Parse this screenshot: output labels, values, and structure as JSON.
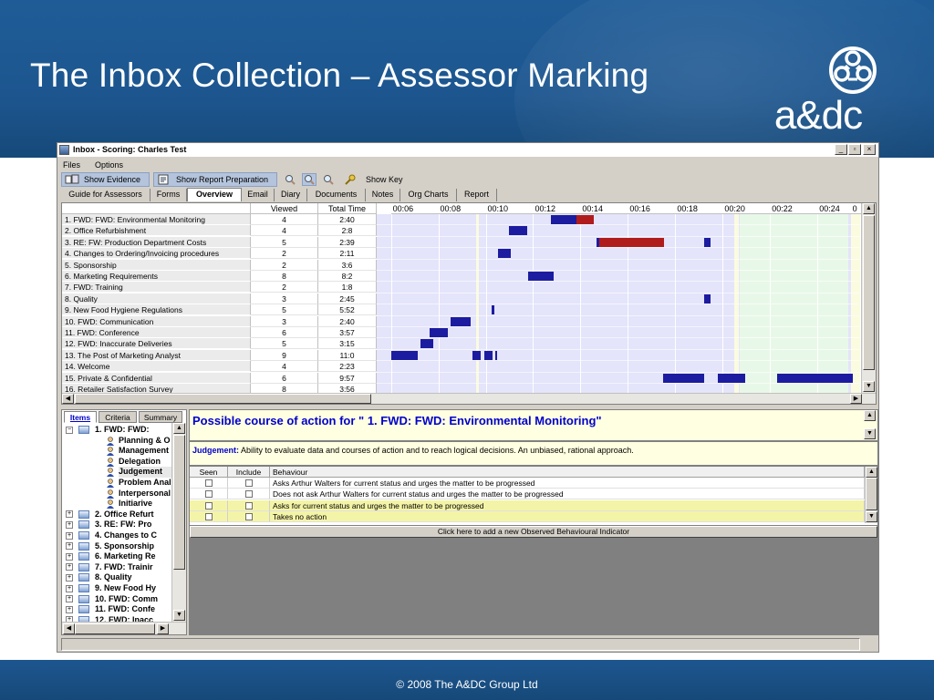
{
  "slide": {
    "title": "The Inbox Collection – Assessor Marking",
    "logo_text": "a&dc",
    "footer": "© 2008 The A&DC Group Ltd",
    "header_color": "#1d568f"
  },
  "window": {
    "title": "Inbox - Scoring: Charles Test",
    "controls": [
      "_",
      "▫",
      "×"
    ]
  },
  "menu": {
    "files": "Files",
    "options": "Options"
  },
  "toolbar": {
    "show_evidence": "Show Evidence",
    "show_report_preparation": "Show Report Preparation",
    "show_key": "Show Key",
    "icons": [
      "magnifier-icon",
      "zoom-in-icon",
      "zoom-out-icon",
      "key-icon"
    ]
  },
  "tabs": [
    "Guide for Assessors",
    "Forms",
    "Overview",
    "Email",
    "Diary",
    "Documents",
    "Notes",
    "Org Charts",
    "Report"
  ],
  "active_tab": "Overview",
  "overview": {
    "columns": {
      "viewed": "Viewed",
      "total_time": "Total Time"
    },
    "time_ticks": [
      "00:06",
      "00:08",
      "00:10",
      "00:12",
      "00:14",
      "00:16",
      "00:18",
      "00:20",
      "00:22",
      "00:24",
      "0"
    ],
    "rows": [
      {
        "name": "1. FWD: FWD: Environmental Monitoring",
        "viewed": "4",
        "total": "2:40"
      },
      {
        "name": "2. Office Refurbishment",
        "viewed": "4",
        "total": "2:8"
      },
      {
        "name": "3. RE: FW: Production Department Costs",
        "viewed": "5",
        "total": "2:39"
      },
      {
        "name": "4. Changes to Ordering/Invoicing procedures",
        "viewed": "2",
        "total": "2:11"
      },
      {
        "name": "5. Sponsorship",
        "viewed": "2",
        "total": "3:6"
      },
      {
        "name": "6. Marketing Requirements",
        "viewed": "8",
        "total": "8:2"
      },
      {
        "name": "7. FWD: Training",
        "viewed": "2",
        "total": "1:8"
      },
      {
        "name": "8. Quality",
        "viewed": "3",
        "total": "2:45"
      },
      {
        "name": "9. New Food Hygiene Regulations",
        "viewed": "5",
        "total": "5:52"
      },
      {
        "name": "10. FWD: Communication",
        "viewed": "3",
        "total": "2:40"
      },
      {
        "name": "11. FWD: Conference",
        "viewed": "6",
        "total": "3:57"
      },
      {
        "name": "12. FWD: Inaccurate Deliveries",
        "viewed": "5",
        "total": "3:15"
      },
      {
        "name": "13. The Post of Marketing Analyst",
        "viewed": "9",
        "total": "11:0"
      },
      {
        "name": "14. Welcome",
        "viewed": "4",
        "total": "2:23"
      },
      {
        "name": "15. Private & Confidential",
        "viewed": "6",
        "total": "9:57"
      },
      {
        "name": "16. Retailer Satisfaction Survey",
        "viewed": "8",
        "total": "3:56"
      }
    ],
    "bar_colors": {
      "viewing": "#1c1ca0",
      "current": "#b01c1c",
      "lilac_band": "#e4e4fb",
      "green_band": "#e8f8e8"
    },
    "bars": [
      {
        "row": 0,
        "start": 12.75,
        "end": 13.82,
        "kind": "viewing"
      },
      {
        "row": 0,
        "start": 13.82,
        "end": 14.55,
        "kind": "current"
      },
      {
        "row": 1,
        "start": 11.0,
        "end": 11.75,
        "kind": "viewing"
      },
      {
        "row": 2,
        "start": 14.68,
        "end": 14.8,
        "kind": "viewing"
      },
      {
        "row": 2,
        "start": 14.8,
        "end": 17.52,
        "kind": "current"
      },
      {
        "row": 2,
        "start": 19.2,
        "end": 19.5,
        "kind": "viewing"
      },
      {
        "row": 3,
        "start": 10.5,
        "end": 11.05,
        "kind": "viewing"
      },
      {
        "row": 5,
        "start": 11.8,
        "end": 12.85,
        "kind": "viewing"
      },
      {
        "row": 7,
        "start": 19.2,
        "end": 19.5,
        "kind": "viewing"
      },
      {
        "row": 8,
        "start": 10.25,
        "end": 10.35,
        "kind": "viewing"
      },
      {
        "row": 9,
        "start": 8.5,
        "end": 9.35,
        "kind": "viewing"
      },
      {
        "row": 10,
        "start": 7.65,
        "end": 8.4,
        "kind": "viewing"
      },
      {
        "row": 11,
        "start": 7.25,
        "end": 7.8,
        "kind": "viewing"
      },
      {
        "row": 12,
        "start": 6.0,
        "end": 7.15,
        "kind": "viewing"
      },
      {
        "row": 12,
        "start": 9.45,
        "end": 9.8,
        "kind": "viewing"
      },
      {
        "row": 12,
        "start": 9.95,
        "end": 10.3,
        "kind": "viewing"
      },
      {
        "row": 12,
        "start": 10.4,
        "end": 10.5,
        "kind": "viewing"
      },
      {
        "row": 14,
        "start": 17.5,
        "end": 19.2,
        "kind": "viewing"
      },
      {
        "row": 14,
        "start": 19.8,
        "end": 20.95,
        "kind": "viewing"
      },
      {
        "row": 14,
        "start": 22.3,
        "end": 25.5,
        "kind": "viewing"
      }
    ]
  },
  "left_tabs": [
    "Items",
    "Criteria",
    "Summary"
  ],
  "tree": [
    {
      "label": "1. FWD: FWD:",
      "level": 0,
      "expand": "−",
      "icon": "document-icon"
    },
    {
      "label": "Planning & O",
      "level": 1,
      "icon": "person-icon"
    },
    {
      "label": "Management",
      "level": 1,
      "icon": "person-icon"
    },
    {
      "label": "Delegation",
      "level": 1,
      "icon": "person-icon"
    },
    {
      "label": "Judgement",
      "level": 1,
      "icon": "person-icon",
      "selected": true
    },
    {
      "label": "Problem Anal",
      "level": 1,
      "icon": "person-icon"
    },
    {
      "label": "Interpersonal",
      "level": 1,
      "icon": "person-icon"
    },
    {
      "label": "Initiarive",
      "level": 1,
      "icon": "person-icon"
    },
    {
      "label": "2. Office Refurt",
      "level": 0,
      "expand": "+",
      "icon": "document-icon"
    },
    {
      "label": "3. RE: FW: Pro",
      "level": 0,
      "expand": "+",
      "icon": "document-icon"
    },
    {
      "label": "4. Changes to C",
      "level": 0,
      "expand": "+",
      "icon": "document-icon"
    },
    {
      "label": "5. Sponsorship",
      "level": 0,
      "expand": "+",
      "icon": "document-icon"
    },
    {
      "label": "6. Marketing Re",
      "level": 0,
      "expand": "+",
      "icon": "document-icon"
    },
    {
      "label": "7. FWD: Trainir",
      "level": 0,
      "expand": "+",
      "icon": "document-icon"
    },
    {
      "label": "8. Quality",
      "level": 0,
      "expand": "+",
      "icon": "document-icon"
    },
    {
      "label": "9. New Food Hy",
      "level": 0,
      "expand": "+",
      "icon": "document-icon"
    },
    {
      "label": "10. FWD: Comm",
      "level": 0,
      "expand": "+",
      "icon": "document-icon"
    },
    {
      "label": "11. FWD: Confe",
      "level": 0,
      "expand": "+",
      "icon": "document-icon"
    },
    {
      "label": "12. FWD: Inacc",
      "level": 0,
      "expand": "+",
      "icon": "document-icon"
    }
  ],
  "detail": {
    "heading": "Possible course of action for \" 1. FWD: FWD: Environmental Monitoring\"",
    "judgement_label": "Judgement:",
    "judgement_text": "Ability to evaluate data and courses of action and to reach logical decisions.  An unbiased, rational approach.",
    "columns": {
      "seen": "Seen",
      "include": "Include",
      "behaviour": "Behaviour"
    },
    "behaviours": [
      {
        "text": "Asks Arthur Walters for current status and urges the matter to be progressed",
        "seen": false,
        "include": false,
        "highlight": false
      },
      {
        "text": "Does not ask Arthur Walters for current status and urges the matter to be progressed",
        "seen": false,
        "include": false,
        "highlight": false
      },
      {
        "text": "Asks for current status and urges the matter to be progressed",
        "seen": false,
        "include": false,
        "highlight": true
      },
      {
        "text": "Takes no action",
        "seen": false,
        "include": false,
        "highlight": true
      }
    ],
    "add_indicator": "Click here to add a new Observed Behavioural Indicator",
    "highlight_color": "#f4f4a8"
  }
}
